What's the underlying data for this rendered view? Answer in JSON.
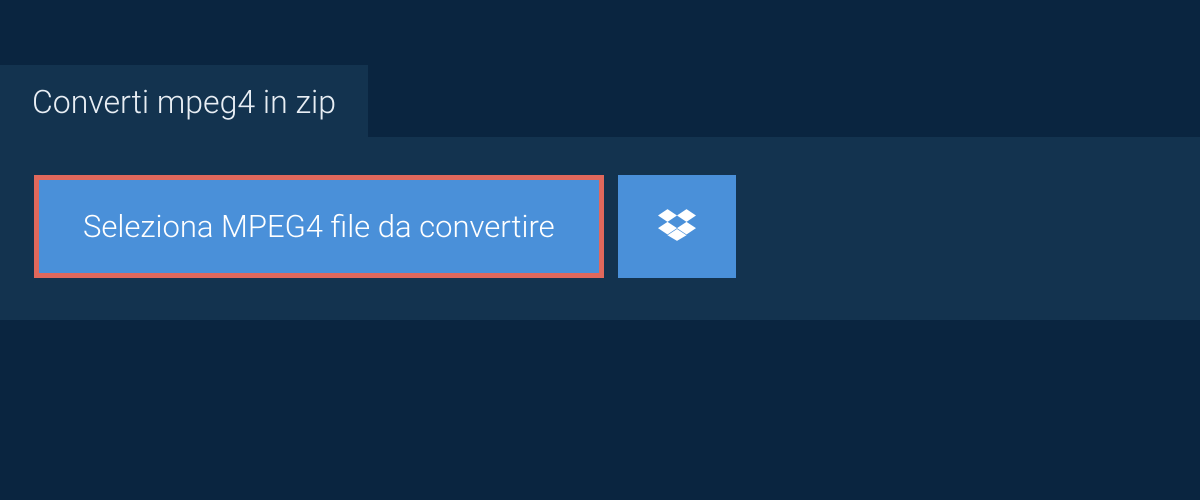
{
  "tab": {
    "title": "Converti mpeg4 in zip"
  },
  "actions": {
    "select_file_label": "Seleziona MPEG4 file da convertire"
  }
}
